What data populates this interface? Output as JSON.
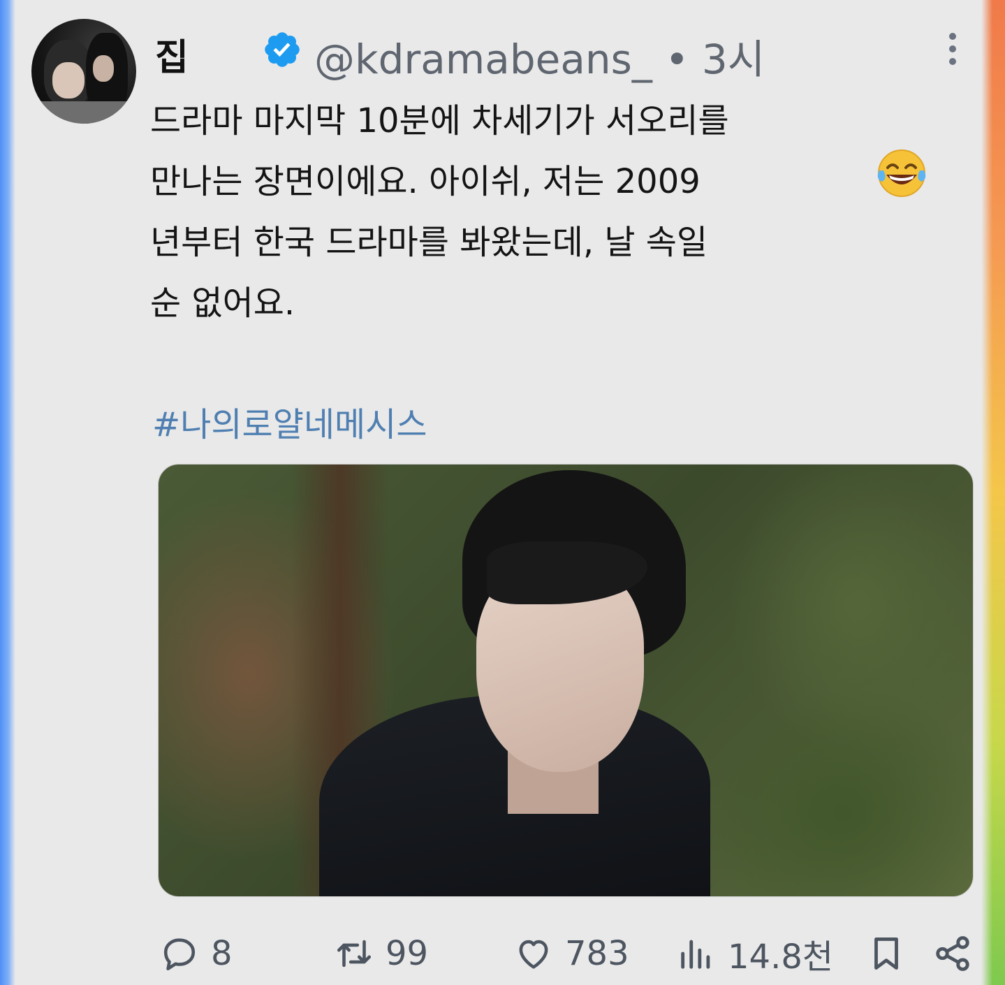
{
  "tweet": {
    "display_name": "집",
    "handle_time": "@kdramabeans_ • 3시",
    "text_lines": [
      "드라마 마지막 10분에 차세기가 서오리를",
      "만나는 장면이에요. 아이쉬, 저는 2009",
      "년부터 한국 드라마를 봐왔는데, 날 속일",
      "순 없어요."
    ],
    "emoji": "😂",
    "hashtag": "#나의로얄네메시스"
  },
  "actions": {
    "replies": "8",
    "retweets": "99",
    "likes": "783",
    "views": "14.8천"
  },
  "icons": [
    "verified-badge-icon",
    "more-icon",
    "reply-icon",
    "retweet-icon",
    "like-icon",
    "views-icon",
    "bookmark-icon",
    "share-icon"
  ],
  "colors": {
    "verified": "#1d9bf0",
    "hashtag": "#4f7fb1",
    "secondary_text": "#5f6670"
  }
}
